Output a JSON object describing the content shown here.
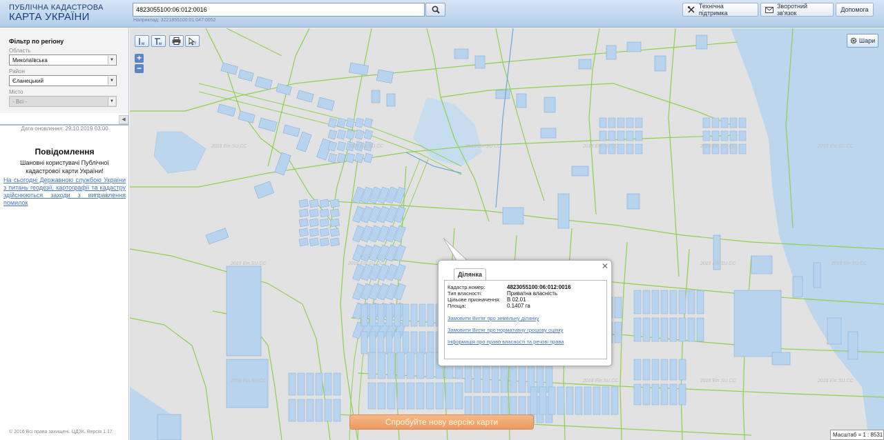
{
  "header": {
    "logo_line1": "ПУБЛІЧНА КАДАСТРОВА",
    "logo_line2": "КАРТА УКРАЇНИ",
    "search_value": "4823055100:06:012:0016",
    "search_hint": "Наприклад: 3221855100:01:047:0052",
    "buttons": {
      "support": "Технічна підтримка",
      "feedback": "Зворотний зв'язок",
      "help": "Допомога"
    }
  },
  "sidebar": {
    "filter_title": "Фільтр по регіону",
    "region_label": "Область",
    "region_value": "Миколаївська",
    "district_label": "Район",
    "district_value": "Єланецький",
    "city_label": "Місто",
    "city_value": "- Всі -",
    "update_date": "Дата оновлення: 29.10.2019 03:00",
    "notice_title": "Повідомлення",
    "notice_text": "Шановні користувачі Публічної кадастрової карти України!",
    "notice_link": "На сьогодні Державною службою України з питань геодезії, картографії та кадастру здійснюються заходи з виправлення помилок",
    "copyright": "© 2016 Всі права захищені. ЦДЗК. Версія 1.17."
  },
  "map": {
    "layers_label": "Шари",
    "watermark": "2018 Ein.SU.CC",
    "new_version_label": "Спробуйте нову версію карти",
    "scale_label": "Масштаб = 1 : 8531",
    "popup": {
      "tab_label": "Ділянка",
      "rows": [
        {
          "label": "Кадастр.номер:",
          "value": "4823055100:06:012:0016"
        },
        {
          "label": "Тип власності:",
          "value": "Приватна власність"
        },
        {
          "label": "Цільове призначення:",
          "value": "В 02.01"
        },
        {
          "label": "Площа:",
          "value": "0.1407 га"
        }
      ],
      "links": [
        "Замовити Витяг про земельну ділянку",
        "Замовити Витяг про нормативну грошову оцінку",
        "Інформація про право власності та речові права"
      ]
    }
  }
}
